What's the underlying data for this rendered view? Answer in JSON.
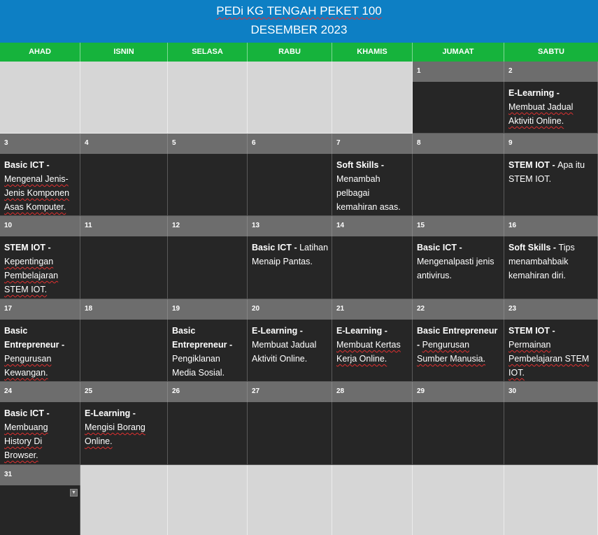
{
  "header": {
    "title": "PEDi KG TENGAH PEKET 100",
    "month": "DESEMBER 2023"
  },
  "weekdays": [
    "AHAD",
    "ISNIN",
    "SELASA",
    "RABU",
    "KHAMIS",
    "JUMAAT",
    "SABTU"
  ],
  "days": {
    "d1": "1",
    "d2": "2",
    "d3": "3",
    "d4": "4",
    "d5": "5",
    "d6": "6",
    "d7": "7",
    "d8": "8",
    "d9": "9",
    "d10": "10",
    "d11": "11",
    "d12": "12",
    "d13": "13",
    "d14": "14",
    "d15": "15",
    "d16": "16",
    "d17": "17",
    "d18": "18",
    "d19": "19",
    "d20": "20",
    "d21": "21",
    "d22": "22",
    "d23": "23",
    "d24": "24",
    "d25": "25",
    "d26": "26",
    "d27": "27",
    "d28": "28",
    "d29": "29",
    "d30": "30",
    "d31": "31"
  },
  "events": {
    "e2": {
      "cat": "E-Learning",
      "sep": " - ",
      "desc": "Membuat Jadual Aktiviti Online."
    },
    "e3": {
      "cat": "Basic ICT",
      "sep": " - ",
      "desc": "Mengenal Jenis-Jenis Komponen Asas Komputer."
    },
    "e7": {
      "cat": "Soft Skills",
      "sep": " - ",
      "desc": "Menambah pelbagai kemahiran asas."
    },
    "e9": {
      "cat": "STEM IOT",
      "sep": " - ",
      "desc": "Apa itu STEM IOT."
    },
    "e10": {
      "cat": "STEM IOT",
      "sep": " - ",
      "desc": "Kepentingan Pembelajaran STEM IOT."
    },
    "e13": {
      "cat": "Basic ICT",
      "sep": " - ",
      "desc": "Latihan Menaip Pantas."
    },
    "e15": {
      "cat": "Basic ICT",
      "sep": " - ",
      "desc": "Mengenalpasti jenis antivirus."
    },
    "e16": {
      "cat": "Soft Skills",
      "sep": " - ",
      "desc": "Tips menambahbaik kemahiran diri."
    },
    "e17": {
      "cat": "Basic Entrepreneur",
      "sep": " - ",
      "desc": "Pengurusan Kewangan."
    },
    "e19": {
      "cat": "Basic Entrepreneur",
      "sep": " - ",
      "desc": "Pengiklanan Media Sosial."
    },
    "e20": {
      "cat": "E-Learning",
      "sep": " - ",
      "desc": "Membuat Jadual Aktiviti Online."
    },
    "e21": {
      "cat": "E-Learning",
      "sep": " - ",
      "desc": "Membuat Kertas Kerja Online."
    },
    "e22": {
      "cat": "Basic Entrepreneur",
      "sep": " - ",
      "desc": "Pengurusan Sumber Manusia."
    },
    "e23": {
      "cat": "STEM IOT",
      "sep": " - ",
      "desc": "Permainan Pembelajaran STEM IOT."
    },
    "e24": {
      "cat": "Basic ICT",
      "sep": " - ",
      "desc": "Membuang History Di Browser."
    },
    "e25": {
      "cat": "E-Learning",
      "sep": " - ",
      "desc": "Mengisi Borang Online."
    }
  },
  "colors": {
    "header": "#0d7fc4",
    "weekday_bar": "#16b33c",
    "day_band": "#6d6d6d",
    "cell": "#262626",
    "outside_month": "#d6d6d6"
  },
  "icons": {
    "cell_menu": "chevron-down-icon"
  }
}
